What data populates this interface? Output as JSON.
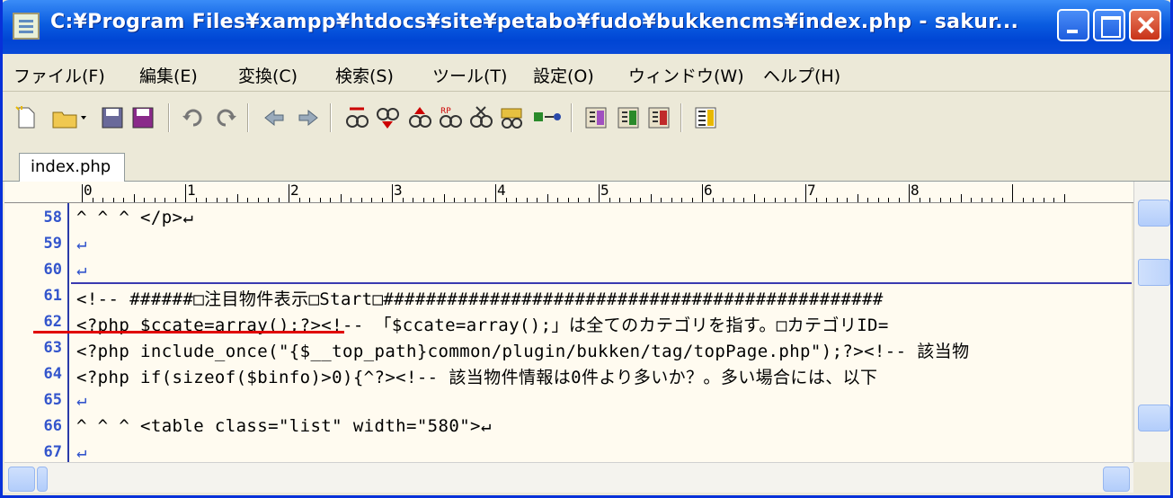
{
  "window": {
    "title": "C:¥Program Files¥xampp¥htdocs¥site¥petabo¥fudo¥bukkencms¥index.php - sakur...",
    "accent": "#0a5ce0"
  },
  "menu": [
    {
      "label": "ファイル(F)"
    },
    {
      "label": "編集(E)"
    },
    {
      "label": "変換(C)"
    },
    {
      "label": "検索(S)"
    },
    {
      "label": "ツール(T)"
    },
    {
      "label": "設定(O)"
    },
    {
      "label": "ウィンドウ(W)"
    },
    {
      "label": "ヘルプ(H)"
    }
  ],
  "tab": {
    "label": "index.php"
  },
  "ruler": {
    "marks": [
      "0",
      "1",
      "2",
      "3",
      "4",
      "5",
      "6",
      "7",
      "8"
    ]
  },
  "lines": [
    {
      "num": "58",
      "text": "^   ^   ^   </p>↵"
    },
    {
      "num": "59",
      "text": "↵"
    },
    {
      "num": "60",
      "text": "↵"
    },
    {
      "num": "61",
      "text": "<!-- ######□注目物件表示□Start□###############################################"
    },
    {
      "num": "62",
      "text": "<?php $ccate=array();?><!-- 「$ccate=array();」は全てのカテゴリを指す。□カテゴリID="
    },
    {
      "num": "63",
      "text": "<?php include_once(\"{$__top_path}common/plugin/bukken/tag/topPage.php\");?><!-- 該当物"
    },
    {
      "num": "64",
      "text": "<?php if(sizeof($binfo)>0){^?><!-- 該当物件情報は0件より多いか？。多い場合には、以下"
    },
    {
      "num": "65",
      "text": "↵"
    },
    {
      "num": "66",
      "text": "^   ^   ^   <table class=\"list\" width=\"580\">↵"
    },
    {
      "num": "67",
      "text": "↵"
    }
  ]
}
